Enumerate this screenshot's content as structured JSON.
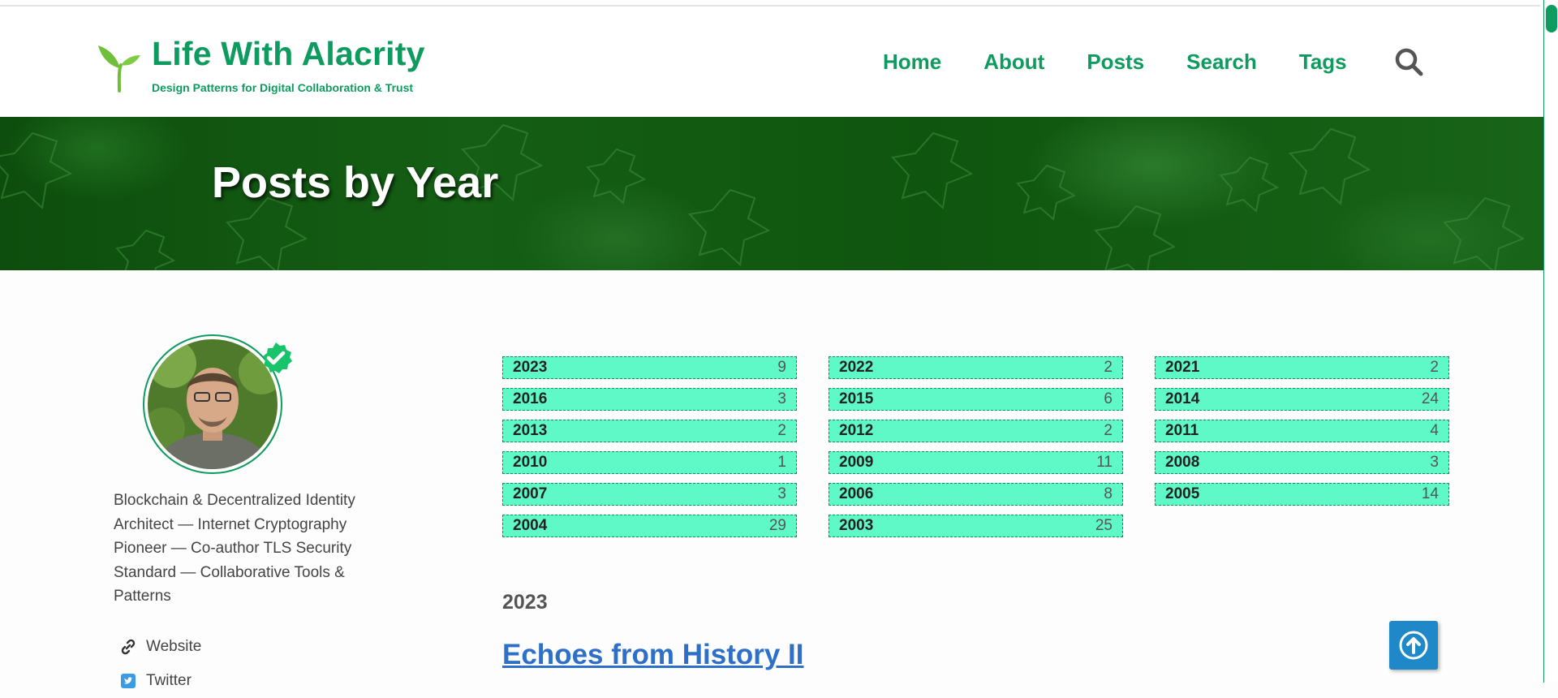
{
  "site": {
    "title": "Life With Alacrity",
    "tagline": "Design Patterns for Digital Collaboration & Trust"
  },
  "nav": {
    "items": [
      {
        "label": "Home"
      },
      {
        "label": "About"
      },
      {
        "label": "Posts"
      },
      {
        "label": "Search"
      },
      {
        "label": "Tags"
      }
    ],
    "search_icon": "magnifier"
  },
  "hero": {
    "title": "Posts by Year"
  },
  "sidebar": {
    "bio": "Blockchain & Decentralized Identity Architect — Internet Cryptography Pioneer — Co-author TLS Security Standard — Collaborative Tools & Patterns",
    "links": [
      {
        "label": "Website",
        "icon": "link-icon"
      },
      {
        "label": "Twitter",
        "icon": "twitter-icon"
      }
    ]
  },
  "years": [
    {
      "year": "2023",
      "count": "9"
    },
    {
      "year": "2022",
      "count": "2"
    },
    {
      "year": "2021",
      "count": "2"
    },
    {
      "year": "2016",
      "count": "3"
    },
    {
      "year": "2015",
      "count": "6"
    },
    {
      "year": "2014",
      "count": "24"
    },
    {
      "year": "2013",
      "count": "2"
    },
    {
      "year": "2012",
      "count": "2"
    },
    {
      "year": "2011",
      "count": "4"
    },
    {
      "year": "2010",
      "count": "1"
    },
    {
      "year": "2009",
      "count": "11"
    },
    {
      "year": "2008",
      "count": "3"
    },
    {
      "year": "2007",
      "count": "3"
    },
    {
      "year": "2006",
      "count": "8"
    },
    {
      "year": "2005",
      "count": "14"
    },
    {
      "year": "2004",
      "count": "29"
    },
    {
      "year": "2003",
      "count": "25"
    }
  ],
  "section": {
    "year": "2023"
  },
  "posts": [
    {
      "title": "Echoes from History II"
    }
  ],
  "colors": {
    "brand_green": "#0f9b5f",
    "year_tag_bg": "#5ef9c6",
    "link_blue": "#2e6fc8",
    "to_top_bg": "#1e88c8"
  }
}
